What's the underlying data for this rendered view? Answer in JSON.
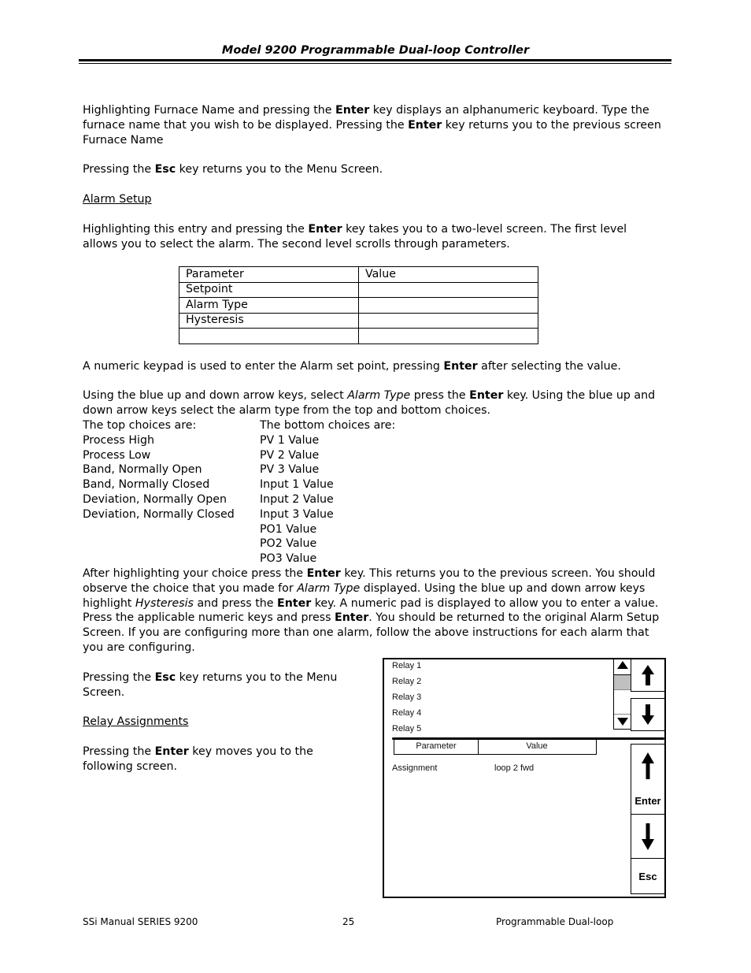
{
  "header": {
    "title": "Model 9200 Programmable Dual-loop Controller"
  },
  "body": {
    "p1": {
      "a": "Highlighting Furnace Name and pressing the ",
      "b1": "Enter",
      "c": " key displays an alphanumeric keyboard. Type the furnace name that you wish to be displayed. Pressing the ",
      "b2": "Enter",
      "d": " key returns you to the previous screen Furnace Name"
    },
    "p2": {
      "a": "Pressing the ",
      "b": "Esc",
      "c": " key returns you to the Menu Screen."
    },
    "alarm_heading": "Alarm Setup",
    "p3": {
      "a": "Highlighting this entry and pressing the ",
      "b": "Enter",
      "c": " key takes you to a two-level screen. The first level allows you to select the alarm. The second level scrolls through parameters."
    },
    "alarm_table": {
      "headers": [
        "Parameter",
        "Value"
      ],
      "rows": [
        [
          "Setpoint",
          ""
        ],
        [
          "Alarm Type",
          ""
        ],
        [
          "Hysteresis",
          ""
        ],
        [
          "",
          ""
        ]
      ]
    },
    "p4": {
      "a": "A numeric keypad is used to enter the Alarm set point, pressing ",
      "b": "Enter",
      "c": " after selecting the value."
    },
    "p5": {
      "a": "Using the blue up and down arrow keys, select ",
      "i": "Alarm Type",
      "b": " press the ",
      "k": "Enter",
      "c": " key. Using the blue up and down arrow keys select the alarm type from the top and bottom choices."
    },
    "top_choices_label": "The top choices are:",
    "bottom_choices_label": "The bottom choices are:",
    "top_choices": [
      "Process High",
      "Process Low",
      "Band, Normally Open",
      "Band, Normally Closed",
      "Deviation, Normally Open",
      "Deviation, Normally Closed"
    ],
    "bottom_choices": [
      "PV 1 Value",
      "PV 2 Value",
      "PV 3 Value",
      "Input 1 Value",
      "Input 2 Value",
      "Input 3 Value",
      "PO1 Value",
      "PO2 Value",
      "PO3 Value"
    ],
    "p6": {
      "a": "After highlighting your choice press the ",
      "b1": "Enter",
      "c": " key. This returns you to the previous screen. You should observe the choice that you made for ",
      "i1": "Alarm Type",
      "d": " displayed. Using the blue up and down arrow keys highlight ",
      "i2": "Hysteresis",
      "e": " and press the ",
      "b2": "Enter",
      "f": " key. A numeric pad is displayed to allow you to enter a value. Press the applicable numeric keys and press ",
      "b3": "Enter",
      "g": ". You should be returned to the original Alarm Setup Screen. If you are configuring more than one alarm, follow the above instructions for each alarm that you are configuring."
    },
    "p7": {
      "a": "Pressing the ",
      "b": "Esc",
      "c": " key returns you to the Menu Screen."
    },
    "relay_heading": "Relay Assignments",
    "p8": {
      "a": "Pressing the ",
      "b": "Enter",
      "c": " key moves you to the following screen."
    }
  },
  "device_screen": {
    "relays": [
      "Relay 1",
      "Relay 2",
      "Relay 3",
      "Relay 4",
      "Relay 5"
    ],
    "table_headers": [
      "Parameter",
      "Value"
    ],
    "param_name": "Assignment",
    "param_value": "loop 2 fwd",
    "buttons": {
      "enter": "Enter",
      "esc": "Esc"
    }
  },
  "footer": {
    "left": "SSi Manual SERIES 9200",
    "center": "25",
    "right": "Programmable Dual-loop"
  }
}
